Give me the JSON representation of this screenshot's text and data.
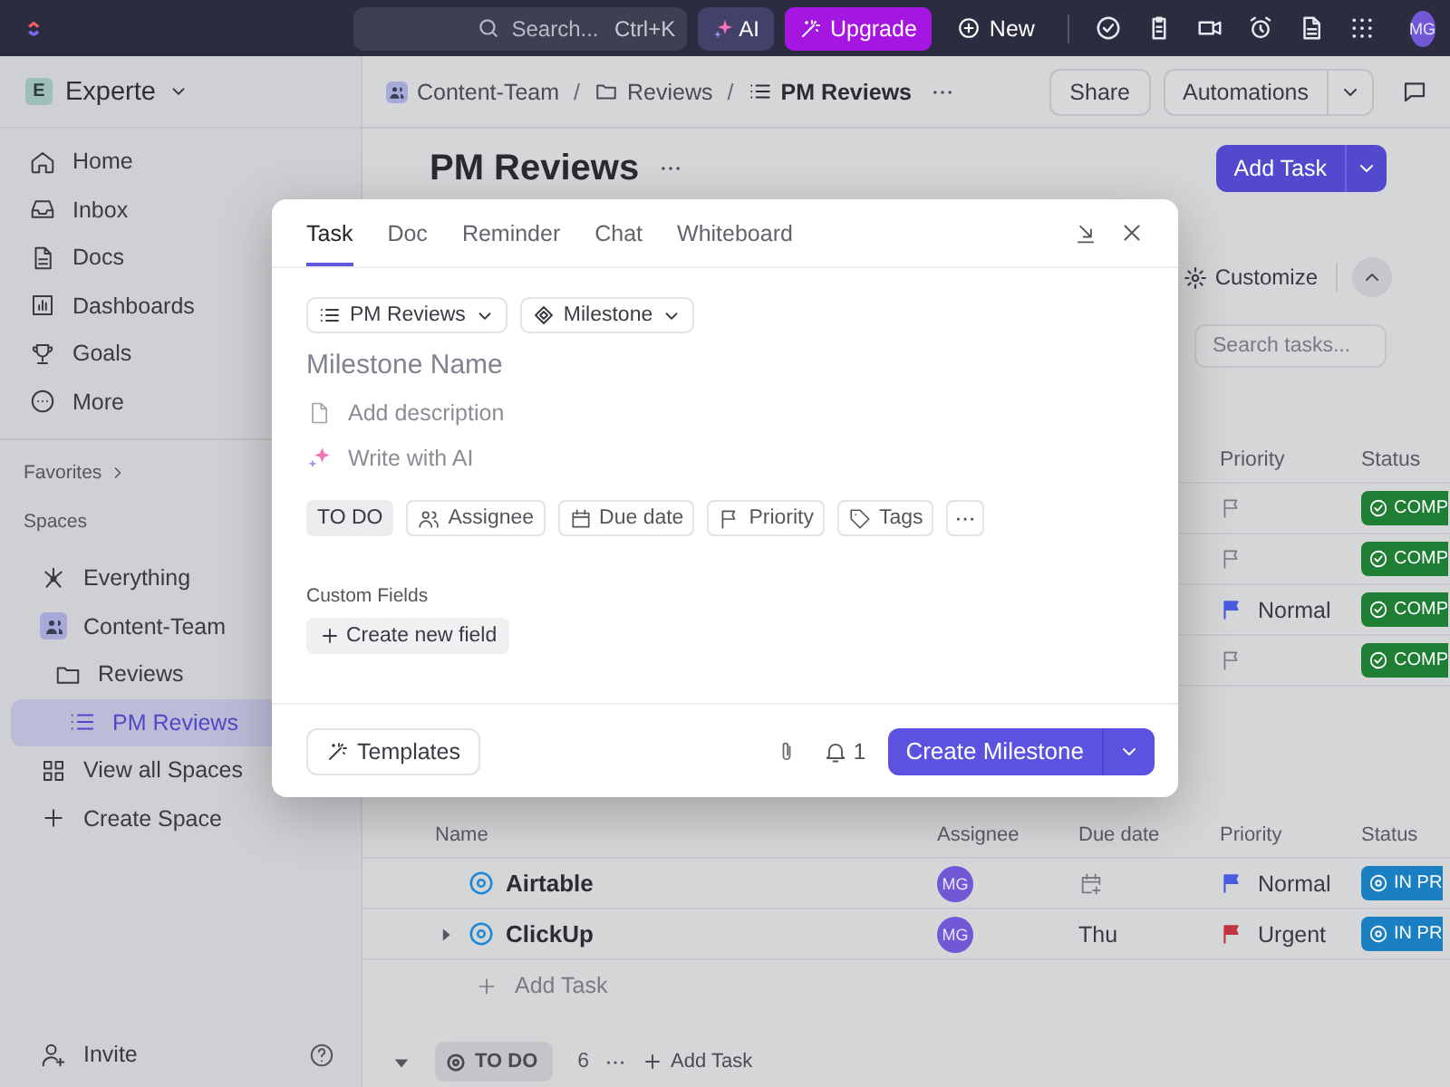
{
  "topbar": {
    "search": {
      "placeholder": "Search...",
      "shortcut": "Ctrl+K"
    },
    "ai_label": "AI",
    "upgrade_label": "Upgrade",
    "new_label": "New",
    "avatar": "MG"
  },
  "workspace": {
    "badge": "E",
    "name": "Experte"
  },
  "nav": [
    {
      "label": "Home",
      "kind": "home"
    },
    {
      "label": "Inbox",
      "kind": "inbox"
    },
    {
      "label": "Docs",
      "kind": "doc"
    },
    {
      "label": "Dashboards",
      "kind": "dashboard"
    },
    {
      "label": "Goals",
      "kind": "trophy"
    },
    {
      "label": "More",
      "kind": "more"
    }
  ],
  "favorites_label": "Favorites",
  "spaces_label": "Spaces",
  "spaces": [
    {
      "label": "Everything",
      "kind": "everything",
      "selected": false
    },
    {
      "label": "Content-Team",
      "kind": "team",
      "selected": false,
      "children": [
        {
          "label": "Reviews",
          "kind": "folder",
          "selected": false,
          "children": [
            {
              "label": "PM Reviews",
              "kind": "list",
              "selected": true
            }
          ]
        }
      ]
    }
  ],
  "space_actions": [
    {
      "label": "View all Spaces",
      "kind": "grid"
    },
    {
      "label": "Create Space",
      "kind": "plus"
    }
  ],
  "invite_label": "Invite",
  "breadcrumb": [
    {
      "label": "Content-Team",
      "kind": "team"
    },
    {
      "separator": "/",
      "label": "Reviews",
      "kind": "folder"
    },
    {
      "separator": "/",
      "label": "PM Reviews",
      "kind": "list"
    }
  ],
  "header_buttons": {
    "share": "Share",
    "automations": "Automations"
  },
  "page": {
    "title": "PM Reviews",
    "add_task": "Add Task",
    "customize": "Customize",
    "search_placeholder": "Search tasks..."
  },
  "upper_table": {
    "columns": [
      "Priority",
      "Status"
    ],
    "rows": [
      {
        "status": {
          "label": "COMP",
          "color": "#1e7e34"
        }
      },
      {
        "status": {
          "label": "COMP",
          "color": "#1e7e34"
        }
      },
      {
        "priority": {
          "label": "Normal",
          "color": "#4a5be0"
        },
        "status": {
          "label": "COMP",
          "color": "#1e7e34"
        }
      },
      {
        "status": {
          "label": "COMP",
          "color": "#1e7e34"
        }
      }
    ]
  },
  "lower_table": {
    "columns": [
      "Name",
      "Assignee",
      "Due date",
      "Priority",
      "Status"
    ],
    "rows": [
      {
        "name": "Airtable",
        "expandable": false,
        "assignee": "MG",
        "priority": {
          "label": "Normal",
          "color": "#4a5be0"
        },
        "status": {
          "label": "IN PR",
          "color": "#1b7fc4"
        }
      },
      {
        "name": "ClickUp",
        "expandable": true,
        "assignee": "MG",
        "due": "Thu",
        "priority": {
          "label": "Urgent",
          "color": "#c0353f"
        },
        "status": {
          "label": "IN PR",
          "color": "#1b7fc4"
        }
      }
    ],
    "add_task_label": "Add Task"
  },
  "group": {
    "label": "TO DO",
    "count": "6",
    "add_label": "Add Task",
    "expanded": true
  },
  "modal": {
    "tabs": [
      {
        "label": "Task",
        "selected": true
      },
      {
        "label": "Doc",
        "selected": false
      },
      {
        "label": "Reminder",
        "selected": false
      },
      {
        "label": "Chat",
        "selected": false
      },
      {
        "label": "Whiteboard",
        "selected": false
      }
    ],
    "location": "PM Reviews",
    "type": "Milestone",
    "name_placeholder": "Milestone Name",
    "description_placeholder": "Add description",
    "ai_label": "Write with AI",
    "status": "TO DO",
    "chips": [
      {
        "label": "Assignee",
        "kind": "team"
      },
      {
        "label": "Due date",
        "kind": "calendar"
      },
      {
        "label": "Priority",
        "kind": "flag"
      },
      {
        "label": "Tags",
        "kind": "tag"
      }
    ],
    "custom_fields_label": "Custom Fields",
    "create_field": "Create new field",
    "templates": "Templates",
    "watchers": "1",
    "submit": "Create Milestone"
  }
}
